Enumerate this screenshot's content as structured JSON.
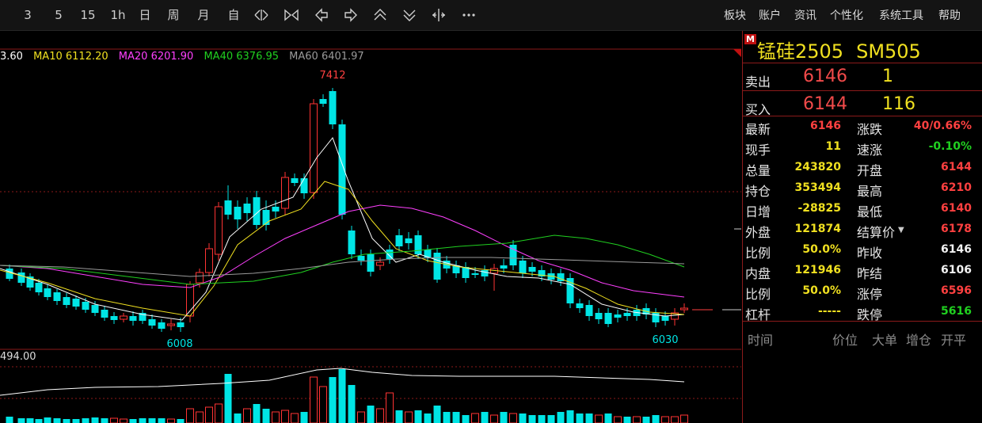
{
  "toolbar": {
    "periods": [
      "3",
      "5",
      "15",
      "1h",
      "日",
      "周",
      "月",
      "自"
    ],
    "menus": [
      "板块",
      "账户",
      "资讯",
      "个性化",
      "系统工具",
      "帮助"
    ]
  },
  "chart": {
    "ma_legend": [
      {
        "text": "3.60",
        "color": "#ffffff"
      },
      {
        "text": "MA10 6112.20",
        "color": "#f0e020"
      },
      {
        "text": "MA20 6201.90",
        "color": "#ff40ff"
      },
      {
        "text": "MA40 6376.95",
        "color": "#20d020"
      },
      {
        "text": "MA60 6401.97",
        "color": "#9a9a9a"
      }
    ],
    "high_label": "7412",
    "low_label_left": "6008",
    "low_label_right": "6030",
    "volume_label": "494.00",
    "colors": {
      "up": "#ff3333",
      "down": "#00e5e5",
      "ma10": "#f0e020",
      "ma20": "#ff40ff",
      "ma40": "#20d020",
      "ma60": "#9a9a9a",
      "ma5": "#ffffff",
      "grid": "#8b1a1a"
    }
  },
  "panel": {
    "badge": "M",
    "name": "锰硅2505",
    "code": "SM505",
    "orderbook": [
      {
        "label": "卖出",
        "price": "6146",
        "vol": "1"
      },
      {
        "label": "买入",
        "price": "6144",
        "vol": "116"
      }
    ],
    "quotes_left": [
      {
        "label": "最新",
        "value": "6146",
        "color": "red"
      },
      {
        "label": "现手",
        "value": "11",
        "color": "yellow"
      },
      {
        "label": "总量",
        "value": "243820",
        "color": "yellow"
      },
      {
        "label": "持仓",
        "value": "353494",
        "color": "yellow"
      },
      {
        "label": "日增",
        "value": "-28825",
        "color": "yellow"
      },
      {
        "label": "外盘",
        "value": "121874",
        "color": "yellow"
      },
      {
        "label": "比例",
        "value": "50.0%",
        "color": "yellow"
      },
      {
        "label": "内盘",
        "value": "121946",
        "color": "yellow"
      },
      {
        "label": "比例",
        "value": "50.0%",
        "color": "yellow"
      },
      {
        "label": "杠杆",
        "value": "-----",
        "color": "yellow"
      }
    ],
    "quotes_right": [
      {
        "label": "涨跌",
        "value": "40/0.66%",
        "color": "red"
      },
      {
        "label": "速涨",
        "value": "-0.10%",
        "color": "green"
      },
      {
        "label": "开盘",
        "value": "6144",
        "color": "red"
      },
      {
        "label": "最高",
        "value": "6210",
        "color": "red"
      },
      {
        "label": "最低",
        "value": "6140",
        "color": "red"
      },
      {
        "label": "结算价",
        "value": "6178",
        "color": "red"
      },
      {
        "label": "昨收",
        "value": "6146",
        "color": "white"
      },
      {
        "label": "昨结",
        "value": "6106",
        "color": "white"
      },
      {
        "label": "涨停",
        "value": "6596",
        "color": "red"
      },
      {
        "label": "跌停",
        "value": "5616",
        "color": "green"
      }
    ],
    "ticks_header": [
      "时间",
      "价位",
      "大单",
      "增仓",
      "开平"
    ]
  }
}
